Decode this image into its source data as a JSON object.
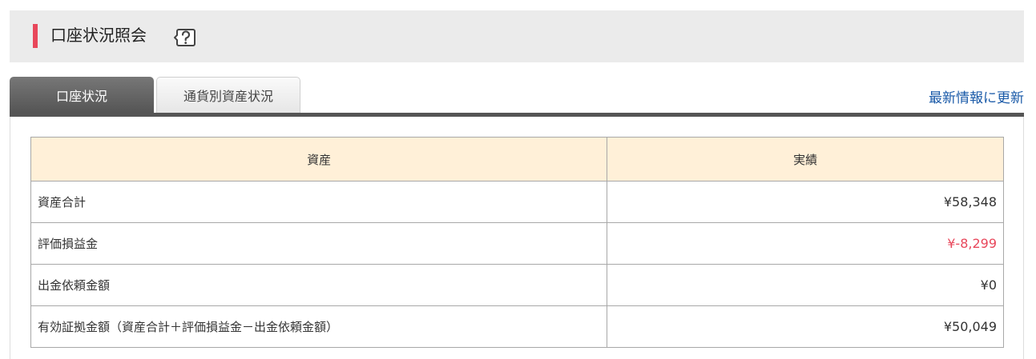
{
  "header": {
    "title": "口座状況照会",
    "help_icon": "help-question-icon"
  },
  "tabs": [
    {
      "label": "口座状況",
      "active": true
    },
    {
      "label": "通貨別資産状況",
      "active": false
    }
  ],
  "refresh_label": "最新情報に更新",
  "table": {
    "columns": [
      "資産",
      "実績"
    ],
    "rows": [
      {
        "label": "資産合計",
        "value": "¥58,348"
      },
      {
        "label": "評価損益金",
        "value": "¥-8,299"
      },
      {
        "label": "出金依頼金額",
        "value": "¥0"
      },
      {
        "label": "有効証拠金額（資産合計＋評価損益金－出金依頼金額）",
        "value": "¥50,049"
      }
    ]
  },
  "colors": {
    "accent": "#e8475b",
    "negative": "#e8475b",
    "link": "#1a5aa8",
    "table_header_bg": "#fff0d8",
    "active_tab_bg": "#666666"
  }
}
